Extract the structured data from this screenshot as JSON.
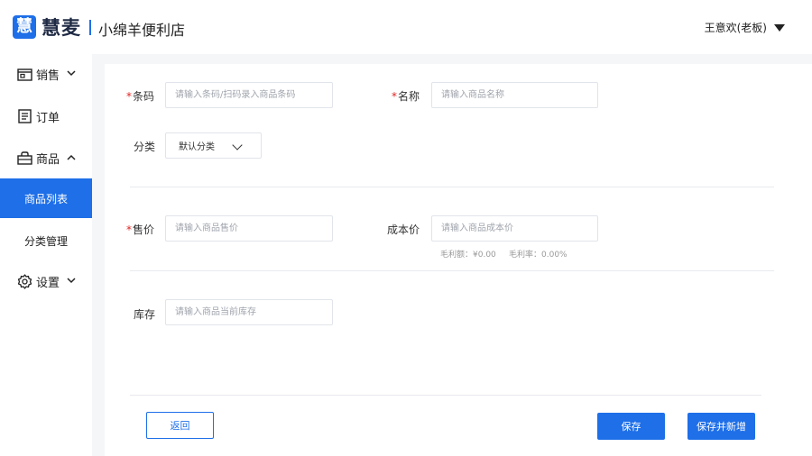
{
  "header": {
    "logo_glyph": "慧",
    "logo_text": "慧麦",
    "store_name": "小绵羊便利店",
    "user": "王意欢(老板)"
  },
  "sidebar": {
    "sales": "销售",
    "orders": "订单",
    "products": "商品",
    "product_list": "商品列表",
    "category_mgmt": "分类管理",
    "settings": "设置"
  },
  "form": {
    "barcode_label": "条码",
    "barcode_placeholder": "请输入条码/扫码录入商品条码",
    "name_label": "名称",
    "name_placeholder": "请输入商品名称",
    "category_label": "分类",
    "category_value": "默认分类",
    "price_label": "售价",
    "price_placeholder": "请输入商品售价",
    "cost_label": "成本价",
    "cost_placeholder": "请输入商品成本价",
    "gross_profit": "毛利额：¥0.00",
    "gross_margin": "毛利率：0.00%",
    "stock_label": "库存",
    "stock_placeholder": "请输入商品当前库存",
    "required_mark": "*"
  },
  "buttons": {
    "back": "返回",
    "save": "保存",
    "save_new": "保存并新增"
  },
  "colors": {
    "primary": "#1e6fe8",
    "required": "#e02424"
  }
}
